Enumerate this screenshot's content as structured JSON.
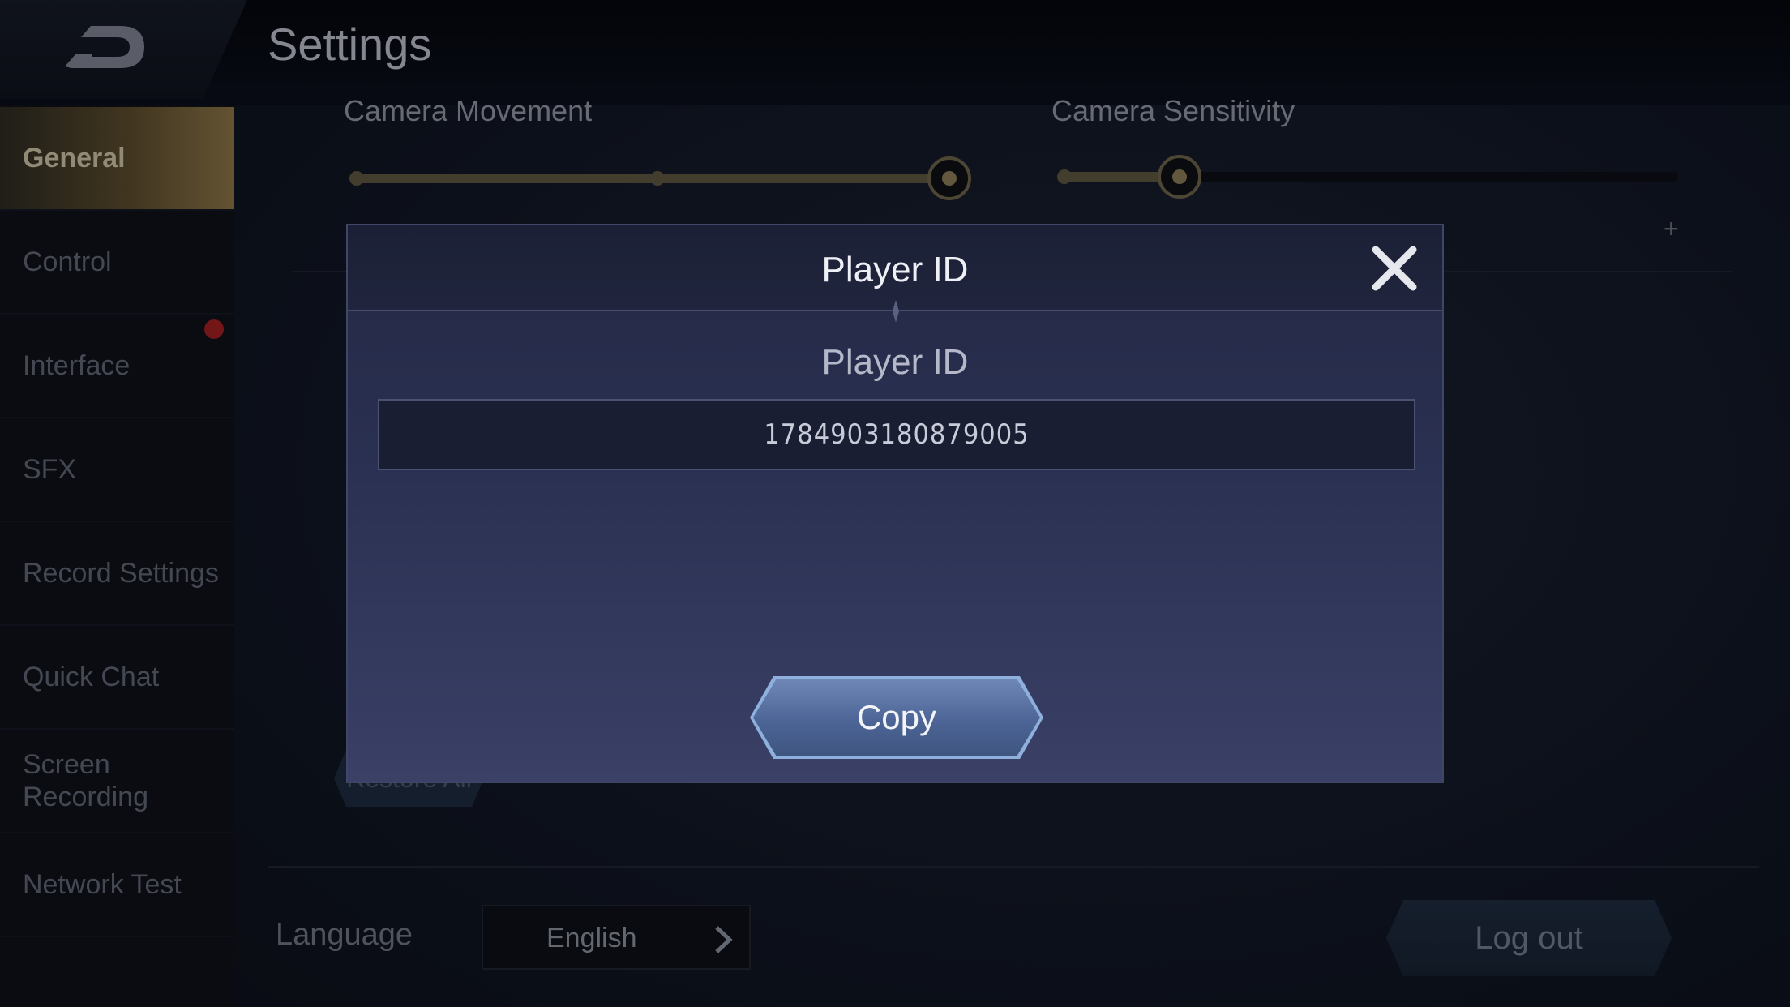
{
  "header": {
    "title": "Settings"
  },
  "sidebar": {
    "items": [
      {
        "label": "General",
        "active": true
      },
      {
        "label": "Control"
      },
      {
        "label": "Interface",
        "notification": true
      },
      {
        "label": "SFX"
      },
      {
        "label": "Record Settings"
      },
      {
        "label": "Quick Chat"
      },
      {
        "label": "Screen Recording"
      },
      {
        "label": "Network Test"
      }
    ]
  },
  "settings": {
    "camera_movement_label": "Camera Movement",
    "camera_sensitivity_label": "Camera Sensitivity",
    "camera_movement_level": 1.0,
    "camera_sensitivity_level": 0.19,
    "plus_symbol": "+",
    "restore_all_label": "Restore All",
    "language_label": "Language",
    "language_value": "English",
    "logout_label": "Log out"
  },
  "modal": {
    "title": "Player ID",
    "subtitle": "Player ID",
    "player_id": "1784903180879005",
    "copy_label": "Copy"
  },
  "colors": {
    "active_gold": "#8a7446",
    "copy_button": "#5a72a4",
    "notification_red": "#9e1f22"
  },
  "icons": [
    "back-icon",
    "close-icon",
    "chevron-right-icon"
  ]
}
